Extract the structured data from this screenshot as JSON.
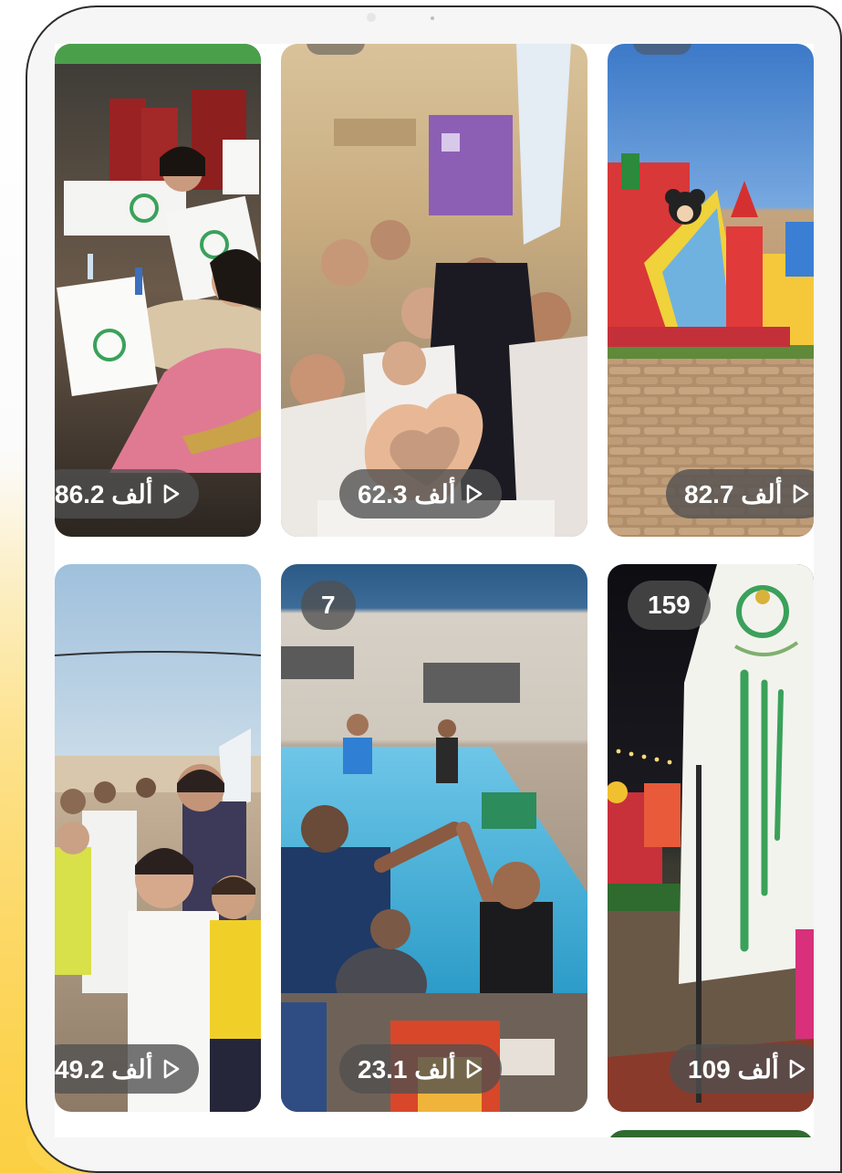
{
  "gallery": {
    "tiles": [
      {
        "views": "86.2 ألف",
        "count": ""
      },
      {
        "views": "62.3 ألف",
        "count": ""
      },
      {
        "views": "82.7 ألف",
        "count": ""
      },
      {
        "views": "49.2 ألف",
        "count": ""
      },
      {
        "views": "23.1 ألف",
        "count": "7"
      },
      {
        "views": "109 ألف",
        "count": "159"
      }
    ]
  },
  "icons": {
    "play": "play-icon"
  },
  "colors": {
    "pill_bg": "#505050",
    "accent_yellow": "#fcd34d",
    "logo_green": "#3aa15a"
  }
}
